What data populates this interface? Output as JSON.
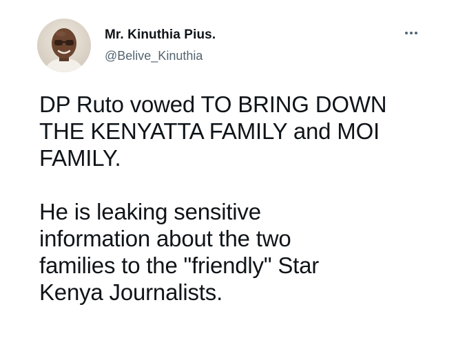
{
  "author": {
    "name": "Mr. Kinuthia Pius.",
    "handle": "@Belive_Kinuthia"
  },
  "menu": {
    "icon": "more-horizontal-icon"
  },
  "tweet": {
    "paragraphs": [
      "DP Ruto vowed TO BRING DOWN\nTHE KENYATTA FAMILY and MOI\nFAMILY.",
      "He is leaking sensitive\ninformation about the two\nfamilies to the \"friendly\" Star\nKenya Journalists."
    ]
  },
  "colors": {
    "text": "#0f1419",
    "secondary": "#536471",
    "background": "#ffffff"
  }
}
